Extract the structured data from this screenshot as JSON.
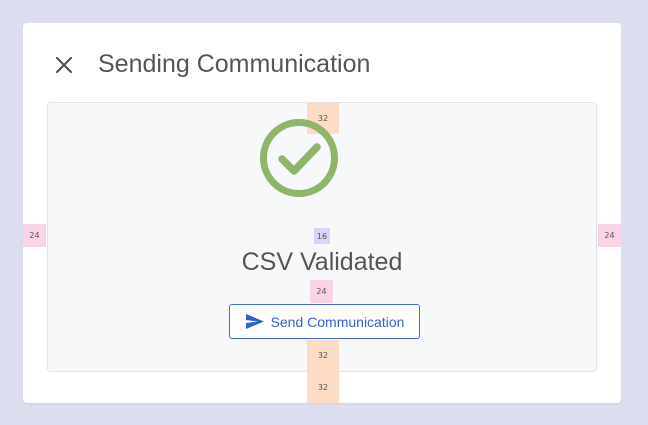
{
  "dialog": {
    "title": "Sending Communication",
    "close_icon": "close-icon"
  },
  "status": {
    "icon": "check-circle-icon",
    "icon_color": "#8fb56a",
    "message": "CSV Validated"
  },
  "send_button": {
    "label": "Send Communication",
    "icon": "send-icon",
    "color": "#2f63c8"
  },
  "spacing_annotations": {
    "top": "32",
    "left": "24",
    "right": "24",
    "icon_gap": "16",
    "text_gap": "24",
    "bottom_inner": "32",
    "bottom_outer": "32"
  }
}
